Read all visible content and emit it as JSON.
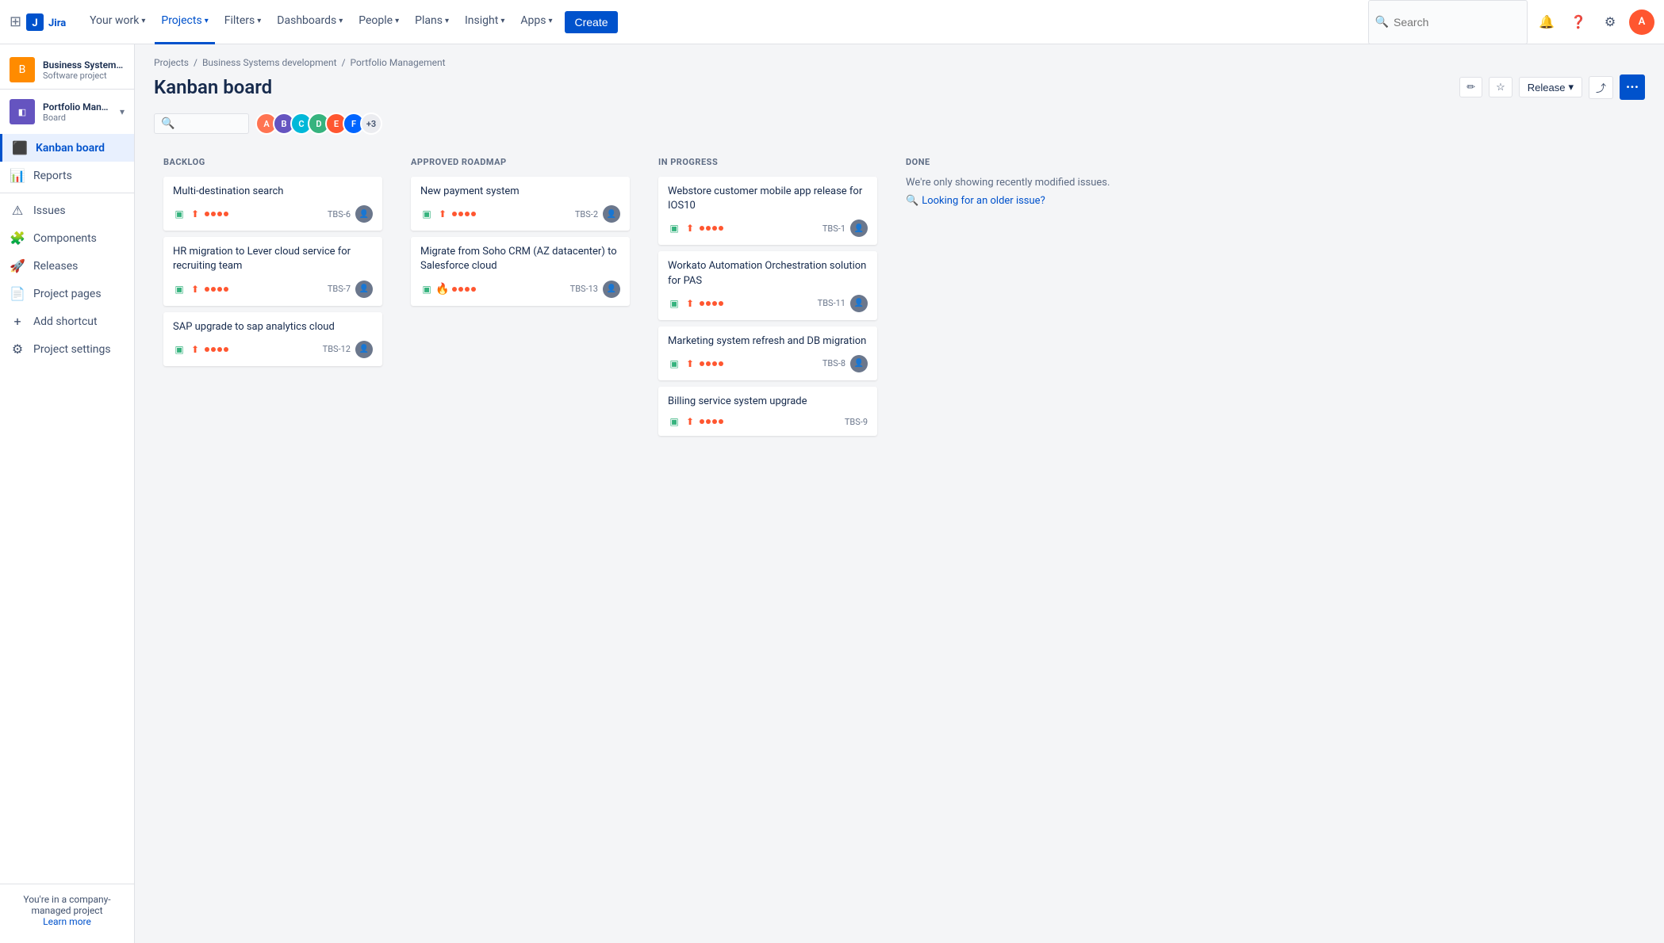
{
  "topnav": {
    "logo": "Jira",
    "nav_items": [
      {
        "label": "Your work",
        "has_dropdown": true,
        "active": false
      },
      {
        "label": "Projects",
        "has_dropdown": true,
        "active": true
      },
      {
        "label": "Filters",
        "has_dropdown": true,
        "active": false
      },
      {
        "label": "Dashboards",
        "has_dropdown": true,
        "active": false
      },
      {
        "label": "People",
        "has_dropdown": true,
        "active": false
      },
      {
        "label": "Plans",
        "has_dropdown": true,
        "active": false
      },
      {
        "label": "Insight",
        "has_dropdown": true,
        "active": false
      },
      {
        "label": "Apps",
        "has_dropdown": true,
        "active": false
      }
    ],
    "create_label": "Create",
    "search_placeholder": "Search"
  },
  "sidebar": {
    "projects": [
      {
        "name": "Business Systems dev...",
        "type": "Software project",
        "icon_text": "B",
        "icon_color": "#ff8b00"
      },
      {
        "name": "Portfolio Manage...",
        "type": "Board",
        "icon_text": "P",
        "icon_color": "#6554c0",
        "has_chevron": true
      }
    ],
    "nav_items": [
      {
        "label": "Kanban board",
        "icon": "⬛",
        "active": true
      },
      {
        "label": "Reports",
        "icon": "📈",
        "active": false
      },
      {
        "label": "",
        "is_divider": true
      },
      {
        "label": "Issues",
        "icon": "⚠",
        "active": false
      },
      {
        "label": "Components",
        "icon": "🧩",
        "active": false
      },
      {
        "label": "Releases",
        "icon": "🚀",
        "active": false
      },
      {
        "label": "Project pages",
        "icon": "📄",
        "active": false
      },
      {
        "label": "Add shortcut",
        "icon": "+",
        "active": false
      },
      {
        "label": "Project settings",
        "icon": "⚙",
        "active": false
      }
    ],
    "footer_text": "You're in a company-managed project",
    "footer_link": "Learn more"
  },
  "breadcrumb": {
    "items": [
      "Projects",
      "Business Systems development",
      "Portfolio Management"
    ]
  },
  "page": {
    "title": "Kanban board",
    "release_label": "Release",
    "actions": {
      "pencil_icon": "✏",
      "star_icon": "☆",
      "share_icon": "⤴",
      "more_icon": "•••"
    }
  },
  "board": {
    "columns": [
      {
        "id": "backlog",
        "label": "BACKLOG",
        "cards": [
          {
            "title": "Multi-destination search",
            "id": "TBS-6",
            "priority": "high",
            "has_avatar": true,
            "avatar_color": "#6b778c"
          },
          {
            "title": "HR migration to Lever cloud service for recruiting team",
            "id": "TBS-7",
            "priority": "high",
            "has_avatar": true,
            "avatar_color": "#6b778c"
          },
          {
            "title": "SAP upgrade to sap analytics cloud",
            "id": "TBS-12",
            "priority": "high",
            "has_avatar": true,
            "avatar_color": "#6b778c"
          }
        ]
      },
      {
        "id": "approved",
        "label": "APPROVED ROADMAP",
        "cards": [
          {
            "title": "New payment system",
            "id": "TBS-2",
            "priority": "high",
            "has_avatar": true,
            "avatar_color": "#6b778c"
          },
          {
            "title": "Migrate from Soho CRM (AZ datacenter) to Salesforce cloud",
            "id": "TBS-13",
            "priority": "highest",
            "has_avatar": true,
            "avatar_color": "#6b778c"
          }
        ]
      },
      {
        "id": "inprogress",
        "label": "IN PROGRESS",
        "cards": [
          {
            "title": "Webstore customer mobile app release for IOS10",
            "id": "TBS-1",
            "priority": "high",
            "has_avatar": true,
            "avatar_color": "#6b778c"
          },
          {
            "title": "Workato Automation Orchestration solution for PAS",
            "id": "TBS-11",
            "priority": "high",
            "has_avatar": true,
            "avatar_color": "#6b778c"
          },
          {
            "title": "Marketing system refresh and DB migration",
            "id": "TBS-8",
            "priority": "high",
            "has_avatar": true,
            "avatar_color": "#6b778c"
          },
          {
            "title": "Billing service system upgrade",
            "id": "TBS-9",
            "priority": "high",
            "has_avatar": false,
            "avatar_color": ""
          }
        ]
      },
      {
        "id": "done",
        "label": "DONE",
        "done_hint": "We're only showing recently modified issues.",
        "done_link": "Looking for an older issue?"
      }
    ]
  },
  "avatars": [
    {
      "color": "#ff7452",
      "initials": "A"
    },
    {
      "color": "#6554c0",
      "initials": "B"
    },
    {
      "color": "#00b8d9",
      "initials": "C"
    },
    {
      "color": "#36b37e",
      "initials": "D"
    },
    {
      "color": "#ff5630",
      "initials": "E"
    },
    {
      "color": "#0065ff",
      "initials": "F"
    },
    {
      "count": "+3"
    }
  ]
}
